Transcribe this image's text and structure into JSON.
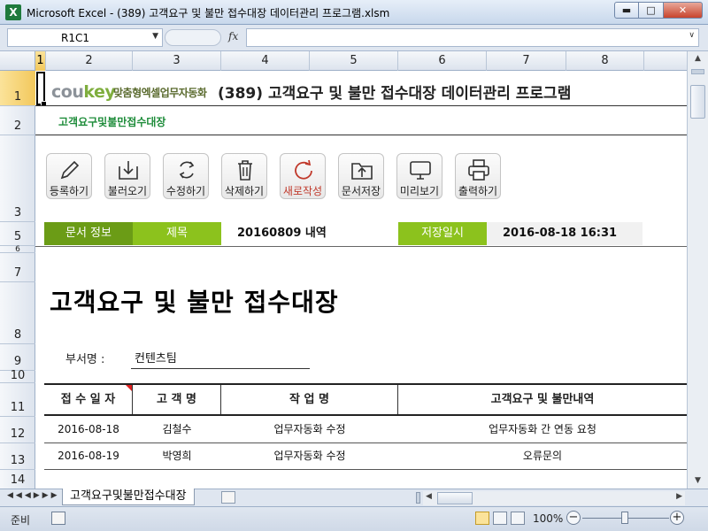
{
  "window": {
    "title": "Microsoft Excel - (389) 고객요구 및 불만 접수대장 데이터관리 프로그램.xlsm",
    "app_icon_text": "X",
    "controls": [
      "minimize",
      "maximize",
      "close"
    ]
  },
  "formula_bar": {
    "name_box": "R1C1",
    "fx_label": "fx",
    "formula": ""
  },
  "columns": [
    "1",
    "2",
    "3",
    "4",
    "5",
    "6",
    "7",
    "8"
  ],
  "rows": [
    "1",
    "2",
    "3",
    "5",
    "6",
    "7",
    "8",
    "9",
    "10",
    "11",
    "12",
    "13",
    "14"
  ],
  "selected_cell": "R1C1",
  "header": {
    "logo_co": "cou",
    "logo_key": "key",
    "logo_sub": "맞춤형엑셀업무자동화",
    "title": "(389) 고객요구 및 불만 접수대장 데이터관리 프로그램",
    "subtitle": "고객요구및불만접수대장"
  },
  "toolbar": [
    {
      "label": "등록하기",
      "icon": "pencil-icon"
    },
    {
      "label": "불러오기",
      "icon": "download-tray-icon"
    },
    {
      "label": "수정하기",
      "icon": "refresh-icon"
    },
    {
      "label": "삭제하기",
      "icon": "trash-icon"
    },
    {
      "label": "새로작성",
      "icon": "new-doc-refresh-icon"
    },
    {
      "label": "문서저장",
      "icon": "upload-folder-icon"
    },
    {
      "label": "미리보기",
      "icon": "monitor-icon"
    },
    {
      "label": "출력하기",
      "icon": "printer-icon"
    }
  ],
  "info_bar": {
    "doc_info_label": "문서 정보",
    "subject_label": "제목",
    "subject_value": "20160809 내역",
    "saved_label": "저장일시",
    "saved_value": "2016-08-18 16:31"
  },
  "document": {
    "title": "고객요구 및 불만 접수대장",
    "dept_label": "부서명 :",
    "dept_value": "컨텐츠팀"
  },
  "table": {
    "headers": [
      "접 수 일 자",
      "고 객 명",
      "작 업 명",
      "고객요구 및 불만내역"
    ],
    "rows": [
      [
        "2016-08-18",
        "김철수",
        "업무자동화 수정",
        "업무자동화 간 연동 요청"
      ],
      [
        "2016-08-19",
        "박영희",
        "업무자동화 수정",
        "오류문의"
      ]
    ]
  },
  "tabs": {
    "sheet_name": "고객요구및불만접수대장"
  },
  "status_bar": {
    "status": "준비",
    "zoom": "100%",
    "zoom_level_percent": 100
  },
  "colors": {
    "green_dark": "#6b9c16",
    "green_light": "#8cc21d",
    "subtitle_green": "#1e8c3a",
    "selection_gold": "#f2c85c"
  }
}
